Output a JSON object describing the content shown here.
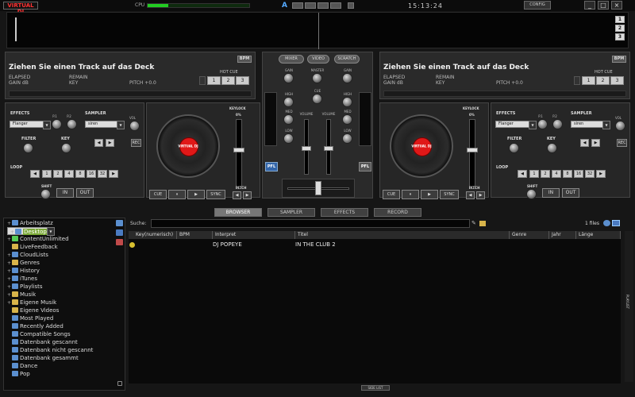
{
  "app": {
    "logo": "VIRTUAL DJ",
    "cpu_label": "CPU",
    "clock": "15:13:24",
    "config_label": "CONFIG",
    "minimize": "_",
    "maximize": "□",
    "close": "×",
    "auto_label": "A"
  },
  "waveform": {
    "zoom_buttons": [
      "1",
      "2",
      "3"
    ]
  },
  "deck_left": {
    "title": "Ziehen Sie einen Track auf das Deck",
    "bpm_label": "BPM",
    "elapsed": "ELAPSED",
    "remain": "REMAIN",
    "gain": "GAIN dB",
    "key": "KEY",
    "pitch": "PITCH +0.0",
    "hotcue_label": "HOT CUE",
    "hotcues": [
      "1",
      "2",
      "3"
    ],
    "effects_label": "EFFECTS",
    "effect": "Flanger",
    "p1": "P.1",
    "p2": "P.2",
    "sampler_label": "SAMPLER",
    "sample": "siren",
    "vol": "VOL",
    "rec": "REC",
    "filter": "FILTER",
    "key_knob": "KEY",
    "loop_label": "LOOP",
    "shift": "SHIFT",
    "loops": [
      "◀",
      "1",
      "2",
      "4",
      "8",
      "16",
      "32",
      "▶"
    ],
    "in": "IN",
    "out": "OUT",
    "keylock": "KEYLOCK",
    "pct": "0%",
    "pitch_lbl": "PITCH",
    "cue": "CUE",
    "pause": "⏸",
    "play": "▶",
    "sync": "SYNC",
    "platter_logo": "VIRTUAL DJ"
  },
  "deck_right": {
    "title": "Ziehen Sie einen Track auf das Deck",
    "bpm_label": "BPM",
    "elapsed": "ELAPSED",
    "remain": "REMAIN",
    "gain": "GAIN dB",
    "key": "KEY",
    "pitch": "PITCH +0.0",
    "hotcue_label": "HOT CUE",
    "hotcues": [
      "1",
      "2",
      "3"
    ],
    "effects_label": "EFFECTS",
    "effect": "Flanger",
    "p1": "P.1",
    "p2": "P.2",
    "sampler_label": "SAMPLER",
    "sample": "siren",
    "vol": "VOL",
    "rec": "REC",
    "filter": "FILTER",
    "key_knob": "KEY",
    "loop_label": "LOOP",
    "shift": "SHIFT",
    "loops": [
      "◀",
      "1",
      "2",
      "4",
      "8",
      "16",
      "32",
      "▶"
    ],
    "in": "IN",
    "out": "OUT",
    "keylock": "KEYLOCK",
    "pct": "0%",
    "pitch_lbl": "PITCH",
    "cue": "CUE",
    "pause": "⏸",
    "play": "▶",
    "sync": "SYNC",
    "platter_logo": "VIRTUAL DJ"
  },
  "mixer": {
    "tabs": [
      "MIXER",
      "VIDEO",
      "SCRATCH"
    ],
    "gain": "GAIN",
    "master": "MASTER",
    "cue": "CUE",
    "high": "HIGH",
    "med": "MED",
    "low": "LOW",
    "volume": "VOLUME",
    "pfl": "PFL"
  },
  "browser_tabs": [
    "BROWSER",
    "SAMPLER",
    "EFFECTS",
    "RECORD"
  ],
  "tree": [
    {
      "label": "Arbeitsplatz",
      "ex": "+",
      "icon": "computer-icon"
    },
    {
      "label": "Desktop",
      "ex": "+",
      "icon": "desktop-icon",
      "selected": true
    },
    {
      "label": "ContentUnlimited",
      "ex": "+",
      "icon": "globe-icon"
    },
    {
      "label": "LiveFeedback",
      "ex": "",
      "icon": "folder-icon"
    },
    {
      "label": "CloudLists",
      "ex": "+",
      "icon": "cloud-icon"
    },
    {
      "label": "Genres",
      "ex": "+",
      "icon": "folder-icon"
    },
    {
      "label": "History",
      "ex": "+",
      "icon": "history-icon"
    },
    {
      "label": "iTunes",
      "ex": "+",
      "icon": "itunes-icon"
    },
    {
      "label": "Playlists",
      "ex": "+",
      "icon": "playlist-icon"
    },
    {
      "label": "Musik",
      "ex": "+",
      "icon": "folder-icon"
    },
    {
      "label": "Eigene Musik",
      "ex": "+",
      "icon": "folder-icon"
    },
    {
      "label": "Eigene Videos",
      "ex": "",
      "icon": "folder-icon"
    },
    {
      "label": "Most Played",
      "ex": "",
      "icon": "filter-folder-icon"
    },
    {
      "label": "Recently Added",
      "ex": "",
      "icon": "filter-folder-icon"
    },
    {
      "label": "Compatible Songs",
      "ex": "",
      "icon": "filter-folder-icon"
    },
    {
      "label": "Datenbank gescannt",
      "ex": "",
      "icon": "filter-folder-icon"
    },
    {
      "label": "Datenbank nicht gescannt",
      "ex": "",
      "icon": "filter-folder-icon"
    },
    {
      "label": "Datenbank gesammt",
      "ex": "",
      "icon": "filter-folder-icon"
    },
    {
      "label": "Dance",
      "ex": "",
      "icon": "filter-folder-icon"
    },
    {
      "label": "Pop",
      "ex": "",
      "icon": "filter-folder-icon"
    }
  ],
  "search": {
    "label": "Suche:",
    "value": "",
    "files": "1 files"
  },
  "table": {
    "columns": [
      "Key(numerisch)",
      "BPM",
      "Interpret",
      "Titel",
      "Genre",
      "Jahr",
      "Länge"
    ],
    "rows": [
      {
        "interpret": "DJ POPEYE",
        "titel": "IN THE CLUB 2"
      }
    ]
  },
  "sidebar_tab": "PLAYLIST",
  "sidelist": "SIDE LIST"
}
